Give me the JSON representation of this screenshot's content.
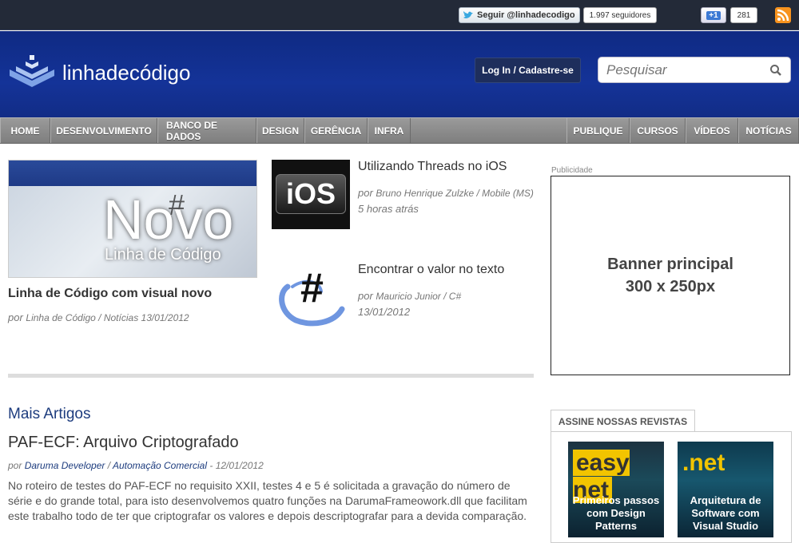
{
  "topbar": {
    "twitter_follow": "Seguir @linhadecodigo",
    "twitter_followers": "1.997 seguidores",
    "gplus_label": "+1",
    "gplus_count": "281"
  },
  "header": {
    "logo_text": "linhadecódigo",
    "login_label": "Log In / Cadastre-se",
    "search_placeholder": "Pesquisar"
  },
  "nav": {
    "left": [
      "HOME",
      "DESENVOLVIMENTO",
      "BANCO DE DADOS",
      "DESIGN",
      "GERÊNCIA",
      "INFRA"
    ],
    "right": [
      "PUBLIQUE",
      "CURSOS",
      "VÍDEOS",
      "NOTÍCIAS"
    ]
  },
  "featured": {
    "img_title": "Novo",
    "img_subtitle": "Linha de Código",
    "title": "Linha de Código com visual novo",
    "by": "por",
    "author": "Linha de Código",
    "sep": " / ",
    "category_date": "Notícias 13/01/2012"
  },
  "articles": [
    {
      "title": "Utilizando Threads no iOS",
      "by": "por",
      "author_cat": "Bruno Henrique Zulzke / Mobile (MS)",
      "date": "5 horas atrás",
      "thumb_text": "iOS"
    },
    {
      "title": "Encontrar o valor no texto",
      "by": "por",
      "author_cat": "Mauricio Junior / C#",
      "date": "13/01/2012",
      "thumb_text": "#"
    }
  ],
  "mais": {
    "heading": "Mais Artigos",
    "title": "PAF-ECF: Arquivo Criptografado",
    "by": "por",
    "author": "Daruma Developer",
    "sep": " / ",
    "category": "Automação Comercial",
    "date": " - 12/01/2012",
    "body": "No roteiro de testes do PAF-ECF no requisito XXII, testes 4 e 5 é solicitada a gravação do número de série e do grande total, para isto desenvolvemos quatro funções na DarumaFrameowork.dll que facilitam este trabalho todo de ter que criptografar os valores e depois descriptografar para a devida comparação."
  },
  "sidebar": {
    "pub_label": "Publicidade",
    "banner_line1": "Banner principal",
    "banner_line2": "300 x 250px",
    "revistas_tab": "ASSINE NOSSAS REVISTAS",
    "mag1_title": "easy net",
    "mag1_caption": "Primeiros passos com Design Patterns",
    "mag2_title": ".net",
    "mag2_caption": "Arquitetura de Software com Visual Studio"
  }
}
